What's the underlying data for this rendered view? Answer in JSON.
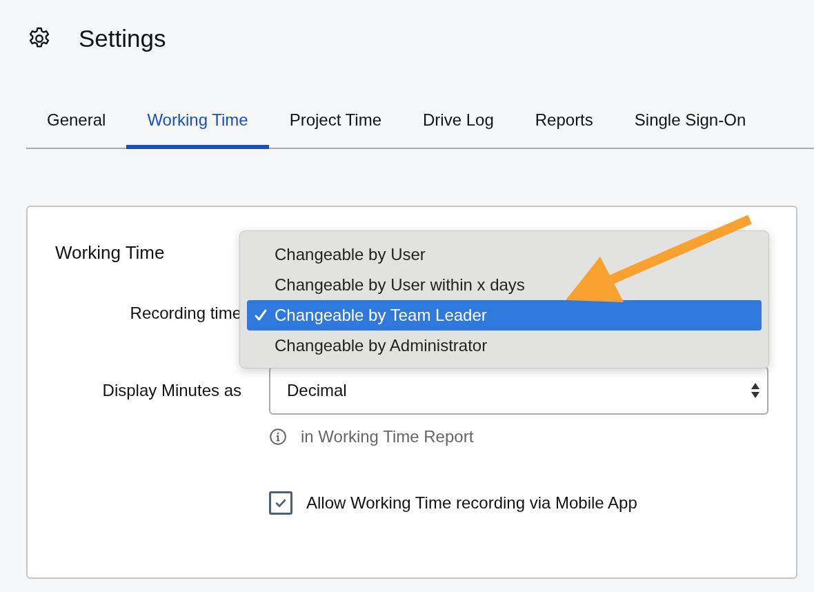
{
  "header": {
    "title": "Settings"
  },
  "tabs": [
    {
      "label": "General",
      "selected": false
    },
    {
      "label": "Working Time",
      "selected": true
    },
    {
      "label": "Project Time",
      "selected": false
    },
    {
      "label": "Drive Log",
      "selected": false
    },
    {
      "label": "Reports",
      "selected": false
    },
    {
      "label": "Single Sign-On",
      "selected": false
    }
  ],
  "section": {
    "title": "Working Time",
    "recording_time": {
      "label": "Recording time",
      "menu": [
        {
          "label": "Changeable by User",
          "selected": false
        },
        {
          "label": "Changeable by User within x days",
          "selected": false
        },
        {
          "label": "Changeable by Team Leader",
          "selected": true
        },
        {
          "label": "Changeable by Administrator",
          "selected": false
        }
      ]
    },
    "display_minutes": {
      "label": "Display Minutes as",
      "value": "Decimal",
      "hint": "in Working Time Report"
    },
    "mobile_app": {
      "label": "Allow Working Time recording via Mobile App",
      "checked": true
    }
  }
}
